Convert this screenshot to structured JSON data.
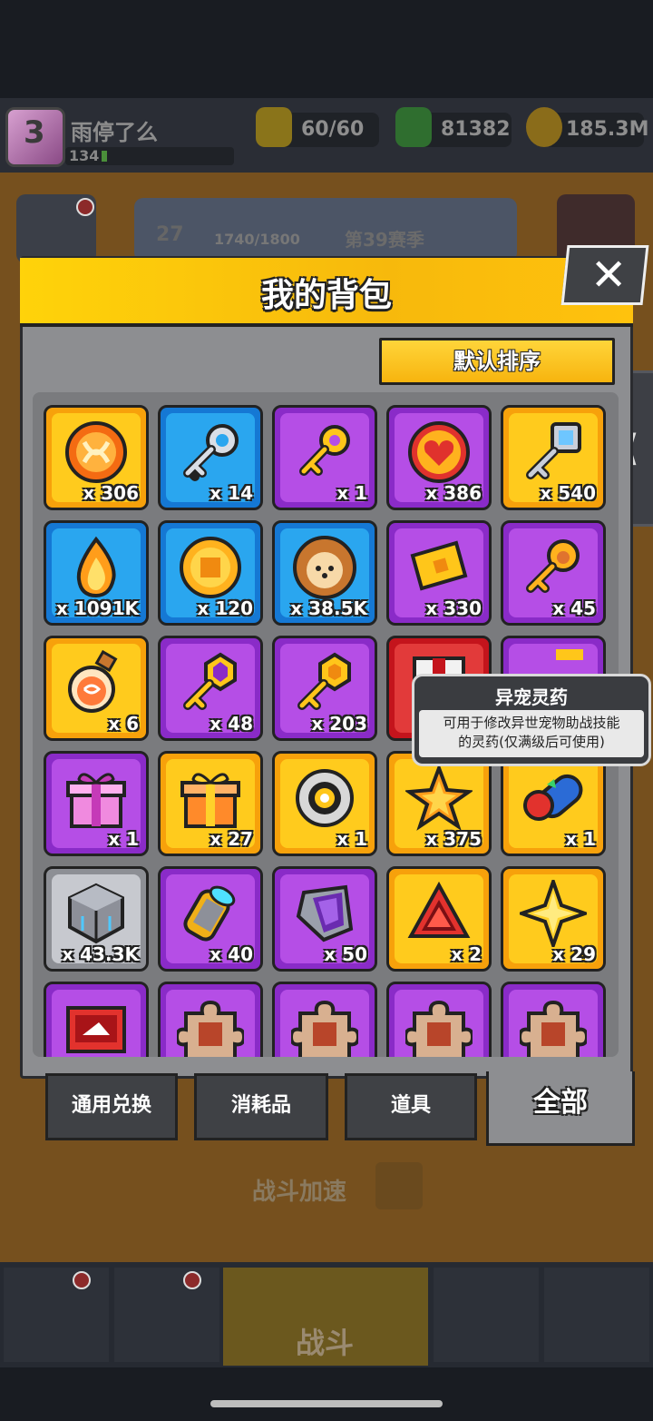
{
  "player": {
    "name": "雨停了么",
    "level": "134",
    "avatar_number": "3"
  },
  "resources": [
    {
      "name": "energy",
      "value": "60/60",
      "icon": "lightning-icon",
      "color": "#b8961e"
    },
    {
      "name": "gems",
      "value": "81382",
      "icon": "green-gem-icon",
      "color": "#3c8a3c"
    },
    {
      "name": "gold",
      "value": "185.3M",
      "icon": "gold-coin-icon",
      "color": "#b8901e"
    }
  ],
  "season": {
    "level": "27",
    "progress": "1740/1800",
    "name": "第39赛季"
  },
  "backpack": {
    "title": "我的背包",
    "sort_label": "默认排序",
    "close_label": "✕",
    "rows": [
      [
        {
          "color": "orange",
          "icon": "orange-orb-icon",
          "count": "x 306"
        },
        {
          "color": "blue",
          "icon": "silver-key-icon",
          "count": "x 14"
        },
        {
          "color": "purple",
          "icon": "gold-key-icon",
          "count": "x 1"
        },
        {
          "color": "purple",
          "icon": "heart-medal-icon",
          "count": "x 386"
        },
        {
          "color": "orange",
          "icon": "gem-key-icon",
          "count": "x 540"
        }
      ],
      [
        {
          "color": "blue",
          "icon": "flame-icon",
          "count": "x 1091K"
        },
        {
          "color": "blue",
          "icon": "gold-token-icon",
          "count": "x 120"
        },
        {
          "color": "blue",
          "icon": "bear-cookie-icon",
          "count": "x 38.5K"
        },
        {
          "color": "purple",
          "icon": "gold-ticket-icon",
          "count": "x 330"
        },
        {
          "color": "purple",
          "icon": "paw-key-icon",
          "count": "x 45"
        }
      ],
      [
        {
          "color": "orange",
          "icon": "potion-flask-icon",
          "count": "x 6"
        },
        {
          "color": "purple",
          "icon": "purple-gem-key-icon",
          "count": "x 48"
        },
        {
          "color": "purple",
          "icon": "hex-key-icon",
          "count": "x 203"
        },
        {
          "color": "red",
          "icon": "red-box-icon",
          "count": ""
        },
        {
          "color": "purple",
          "icon": "hidden-item-icon",
          "count": ""
        }
      ],
      [
        {
          "color": "purple",
          "icon": "pink-gift-icon",
          "count": "x 1"
        },
        {
          "color": "orange",
          "icon": "orange-gift-icon",
          "count": "x 27"
        },
        {
          "color": "orange",
          "icon": "ring-core-icon",
          "count": "x 1"
        },
        {
          "color": "orange",
          "icon": "star-crystal-icon",
          "count": "x 375"
        },
        {
          "color": "orange",
          "icon": "pill-capsule-icon",
          "count": "x 1"
        }
      ],
      [
        {
          "color": "gray",
          "icon": "metal-cube-icon",
          "count": "x 43.3K"
        },
        {
          "color": "purple",
          "icon": "cylinder-core-icon",
          "count": "x 40"
        },
        {
          "color": "purple",
          "icon": "crystal-shard-icon",
          "count": "x 50"
        },
        {
          "color": "orange",
          "icon": "red-triangle-icon",
          "count": "x 2"
        },
        {
          "color": "orange",
          "icon": "gold-star-icon",
          "count": "x 29"
        }
      ],
      [
        {
          "color": "purple",
          "icon": "red-card-icon",
          "count": ""
        },
        {
          "color": "purple",
          "icon": "puzzle-piece-icon",
          "count": ""
        },
        {
          "color": "purple",
          "icon": "puzzle-piece-icon",
          "count": ""
        },
        {
          "color": "purple",
          "icon": "puzzle-piece-icon",
          "count": ""
        },
        {
          "color": "purple",
          "icon": "puzzle-piece-icon",
          "count": ""
        }
      ]
    ],
    "tooltip": {
      "title": "异宠灵药",
      "line1": "可用于修改异世宠物助战技能",
      "line2": "的灵药(仅满级后可使用)"
    },
    "tabs": [
      {
        "label": "通用兑换"
      },
      {
        "label": "消耗品"
      },
      {
        "label": "道具"
      },
      {
        "label": "全部",
        "active": true
      }
    ]
  },
  "background": {
    "battle_speed": "战斗加速",
    "nav_center": "战斗"
  },
  "colors": {
    "orange": "#f7a10b",
    "blue": "#1578d4",
    "purple": "#8a2bc8",
    "gray": "#8d8f95",
    "red": "#c4141c",
    "header_yellow": "#ffd30a"
  }
}
